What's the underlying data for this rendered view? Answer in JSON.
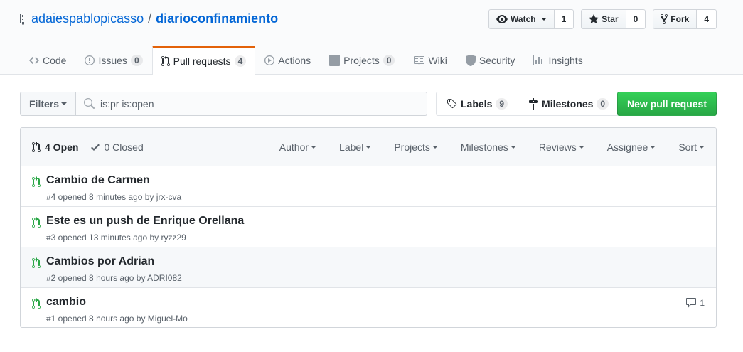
{
  "repo": {
    "owner": "adaiespablopicasso",
    "separator": "/",
    "name": "diarioconfinamiento"
  },
  "actions": {
    "watch": {
      "label": "Watch",
      "count": "1"
    },
    "star": {
      "label": "Star",
      "count": "0"
    },
    "fork": {
      "label": "Fork",
      "count": "4"
    }
  },
  "nav": {
    "code": {
      "label": "Code"
    },
    "issues": {
      "label": "Issues",
      "count": "0"
    },
    "pulls": {
      "label": "Pull requests",
      "count": "4"
    },
    "actions": {
      "label": "Actions"
    },
    "projects": {
      "label": "Projects",
      "count": "0"
    },
    "wiki": {
      "label": "Wiki"
    },
    "security": {
      "label": "Security"
    },
    "insights": {
      "label": "Insights"
    }
  },
  "subnav": {
    "filters_label": "Filters",
    "search_value": "is:pr is:open",
    "labels": {
      "label": "Labels",
      "count": "9"
    },
    "milestones": {
      "label": "Milestones",
      "count": "0"
    },
    "new_pr_label": "New pull request"
  },
  "list": {
    "open_label": "4 Open",
    "closed_label": "0 Closed",
    "sorters": {
      "author": "Author",
      "label": "Label",
      "projects": "Projects",
      "milestones": "Milestones",
      "reviews": "Reviews",
      "assignee": "Assignee",
      "sort": "Sort"
    },
    "items": [
      {
        "title": "Cambio de Carmen",
        "meta": "#4 opened 8 minutes ago by jrx-cva"
      },
      {
        "title": "Este es un push de Enrique Orellana",
        "meta": "#3 opened 13 minutes ago by ryzz29"
      },
      {
        "title": "Cambios por Adrian",
        "meta": "#2 opened 8 hours ago by ADRI082"
      },
      {
        "title": "cambio",
        "meta": "#1 opened 8 hours ago by Miguel-Mo",
        "comments": "1"
      }
    ]
  },
  "colors": {
    "link": "#0366d6",
    "accent_tab": "#e36209",
    "open_pr": "#28a745",
    "primary_button": "#2ea44f"
  }
}
